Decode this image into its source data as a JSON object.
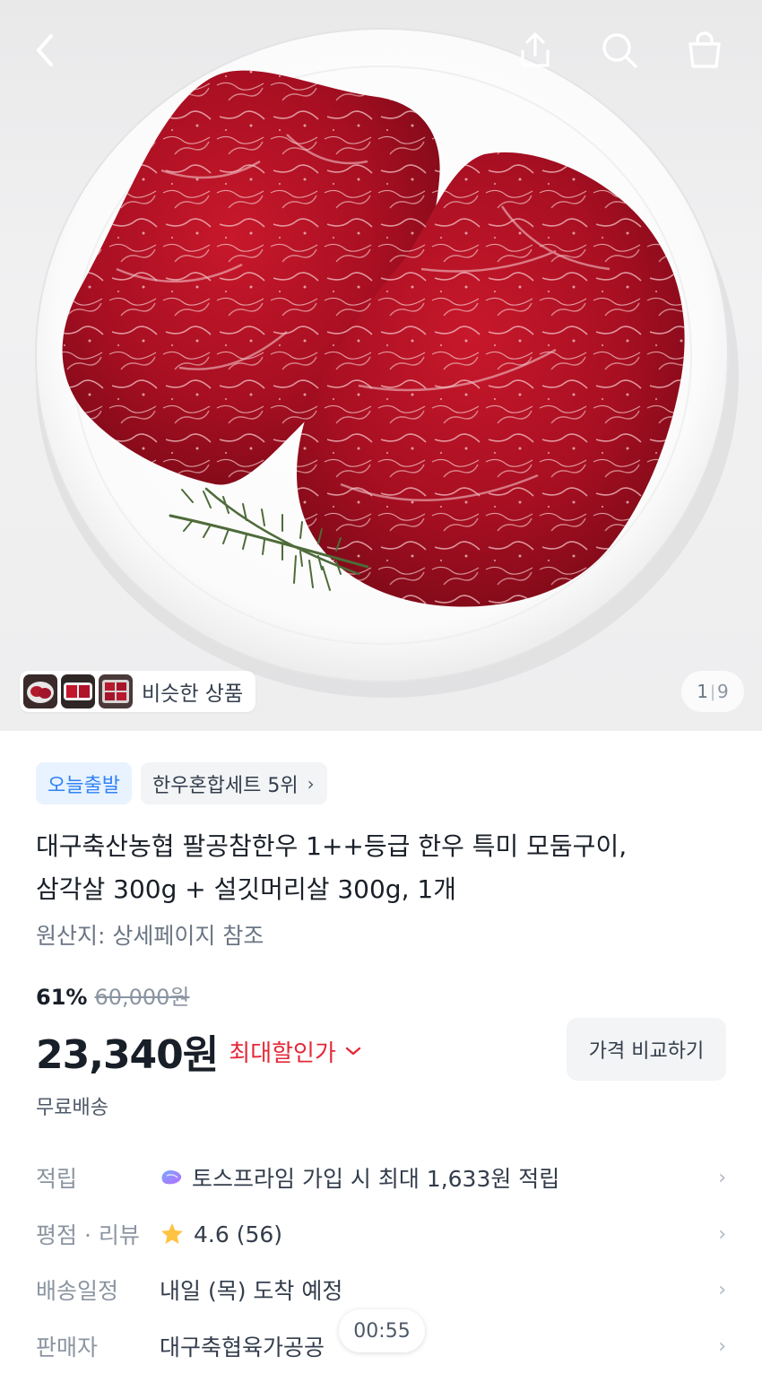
{
  "header": {
    "back_icon": "chevron-left-icon",
    "share_icon": "share-icon",
    "search_icon": "search-icon",
    "cart_icon": "shopping-bag-icon"
  },
  "gallery": {
    "similar_label": "비슷한 상품",
    "current_page": "1",
    "separator": "|",
    "total_pages": "9"
  },
  "product": {
    "badge_today": "오늘출발",
    "badge_rank": "한우혼합세트 5위",
    "badge_rank_chevron": "›",
    "title_line1": "대구축산농협 팔공참한우 1++등급 한우 특미 모둠구이,",
    "title_line2": "삼각살 300g + 설깃머리살 300g, 1개",
    "origin": "원산지: 상세페이지 참조",
    "discount_pct": "61%",
    "original_price": "60,000원",
    "price": "23,340원",
    "max_discount_label": "최대할인가",
    "max_discount_chevron": "⌄",
    "compare_button": "가격 비교하기",
    "shipping": "무료배송"
  },
  "info_rows": [
    {
      "key": "적립",
      "value": "토스프라임 가입 시 최대 1,633원 적립",
      "icon": "toss-prime-icon",
      "arrow": "›"
    },
    {
      "key": "평점 · 리뷰",
      "value": "4.6 (56)",
      "icon": "star-icon",
      "arrow": "›"
    },
    {
      "key": "배송일정",
      "value": "내일 (목) 도착 예정",
      "arrow": "›"
    },
    {
      "key": "판매자",
      "value": "대구축협육가공공",
      "arrow": "›"
    }
  ],
  "overlay": {
    "timer": "00:55"
  },
  "colors": {
    "accent_blue": "#3182f6",
    "discount_red": "#e42939",
    "text_primary": "#191f28",
    "text_secondary": "#8b95a1",
    "star": "#ffc342"
  }
}
